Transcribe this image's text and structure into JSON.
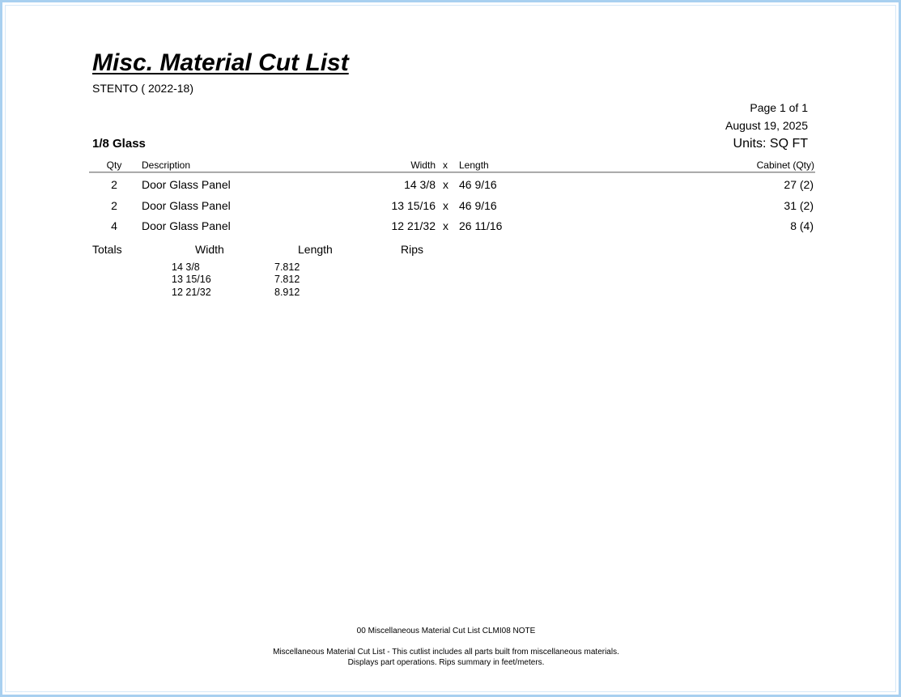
{
  "report": {
    "title": "Misc. Material Cut List",
    "subtitle": "STENTO ( 2022-18)",
    "page": "Page 1 of 1",
    "date": "August 19, 2025",
    "section": "1/8 Glass",
    "units": "Units: SQ FT"
  },
  "table": {
    "headers": {
      "qty": "Qty",
      "description": "Description",
      "width": "Width",
      "x": "x",
      "length": "Length",
      "cabinet": "Cabinet (Qty)"
    },
    "rows": [
      {
        "qty": "2",
        "description": "Door Glass Panel",
        "width": "14 3/8",
        "x": "x",
        "length": "46 9/16",
        "cabinet": "27 (2)"
      },
      {
        "qty": "2",
        "description": "Door Glass Panel",
        "width": "13 15/16",
        "x": "x",
        "length": "46 9/16",
        "cabinet": "31 (2)"
      },
      {
        "qty": "4",
        "description": "Door Glass Panel",
        "width": "12 21/32",
        "x": "x",
        "length": "26 11/16",
        "cabinet": "8 (4)"
      }
    ]
  },
  "totals": {
    "label": "Totals",
    "headers": {
      "width": "Width",
      "length": "Length",
      "rips": "Rips"
    },
    "rows": [
      {
        "width": "14 3/8",
        "length": "7.812"
      },
      {
        "width": "13 15/16",
        "length": "7.812"
      },
      {
        "width": "12 21/32",
        "length": "8.912"
      }
    ]
  },
  "footer": {
    "code": "00 Miscellaneous Material Cut List CLMI08 NOTE",
    "line1": "Miscellaneous Material Cut List - This cutlist includes all parts built from miscellaneous materials.",
    "line2": "Displays part operations. Rips summary in feet/meters."
  }
}
